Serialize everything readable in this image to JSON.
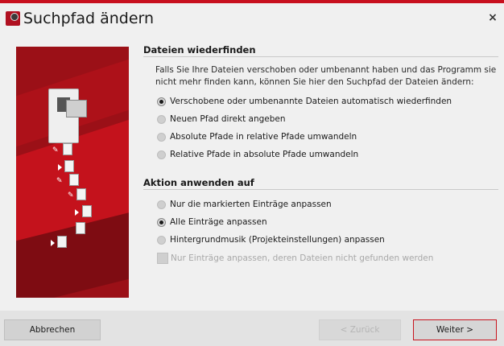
{
  "window": {
    "title": "Suchpfad ändern",
    "close_label": "×"
  },
  "section1": {
    "heading": "Dateien wiederfinden",
    "description": "Falls Sie Ihre Dateien verschoben oder umbenannt haben und das Programm sie nicht mehr finden kann, können Sie hier den Suchpfad der Dateien ändern:",
    "options": [
      {
        "label": "Verschobene oder umbenannte Dateien automatisch wiederfinden",
        "selected": true
      },
      {
        "label": "Neuen Pfad direkt angeben",
        "selected": false
      },
      {
        "label": "Absolute Pfade in relative Pfade umwandeln",
        "selected": false
      },
      {
        "label": "Relative Pfade in absolute Pfade umwandeln",
        "selected": false
      }
    ]
  },
  "section2": {
    "heading": "Aktion anwenden auf",
    "options": [
      {
        "label": "Nur die markierten Einträge anpassen",
        "selected": false
      },
      {
        "label": "Alle Einträge anpassen",
        "selected": true
      },
      {
        "label": "Hintergrundmusik (Projekteinstellungen) anpassen",
        "selected": false
      }
    ],
    "checkbox": {
      "label": "Nur Einträge anpassen, deren Dateien nicht gefunden werden",
      "checked": false,
      "enabled": false
    }
  },
  "buttons": {
    "cancel": "Abbrechen",
    "back": "< Zurück",
    "next": "Weiter >"
  },
  "colors": {
    "accent": "#c8101e",
    "illustration": "#9b1017"
  }
}
